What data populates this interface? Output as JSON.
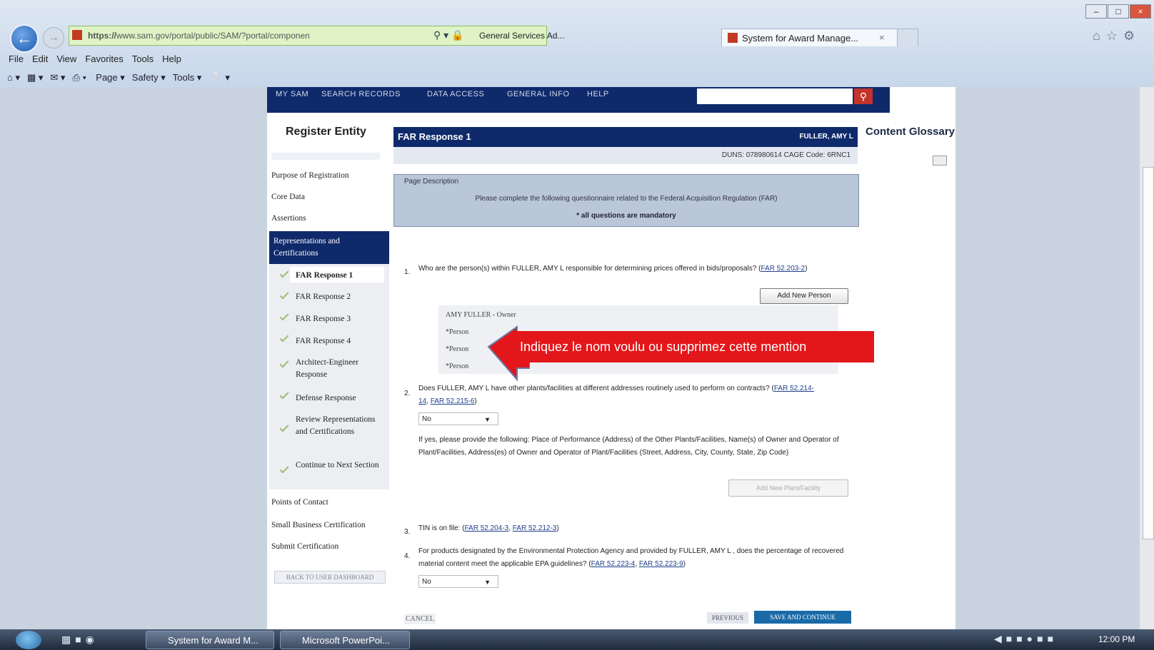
{
  "browser": {
    "url_prefix": "https://",
    "url": "www.sam.gov/portal/public/SAM/?portal/componen",
    "site_label": "General Services Ad...",
    "tab_title": "System for Award Manage...",
    "menu": [
      "File",
      "Edit",
      "View",
      "Favorites",
      "Tools",
      "Help"
    ],
    "command": [
      "Page ▾",
      "Safety ▾",
      "Tools ▾"
    ]
  },
  "sam_nav": [
    "MY SAM",
    "SEARCH RECORDS",
    "DATA ACCESS",
    "GENERAL INFO",
    "HELP"
  ],
  "sidebar": {
    "title": "Register Entity",
    "items": [
      "Purpose of Registration",
      "Core Data",
      "Assertions"
    ],
    "active_section": "Representations and Certifications",
    "sub_items": [
      "FAR Response 1",
      "FAR Response 2",
      "FAR Response 3",
      "FAR Response 4",
      "Architect-Engineer Response",
      "Defense Response",
      "Review Representations and Certifications",
      "Continue to Next Section"
    ],
    "lower_items": [
      "Points of Contact",
      "Small Business Certification",
      "Submit Certification"
    ],
    "back_dashboard": "BACK TO USER DASHBOARD"
  },
  "header": {
    "title": "FAR Response 1",
    "user": "FULLER, AMY L",
    "duns": "DUNS: 078980614   CAGE Code: 6RNC1"
  },
  "glossary": {
    "title": "Content Glossary"
  },
  "description": {
    "label": "Page Description",
    "text": "Please complete the following questionnaire related to the Federal Acquisition Regulation (FAR)",
    "note": "* all questions are mandatory"
  },
  "q1": {
    "num": "1.",
    "text": "Who are the person(s) within FULLER, AMY L responsible for determining prices offered in bids/proposals?",
    "link": "FAR 52.203-2",
    "add_button": "Add New Person",
    "persons": [
      "AMY FULLER - Owner",
      "*Person",
      "*Person",
      "*Person"
    ]
  },
  "callout": "Indiquez le nom voulu ou supprimez cette mention",
  "q2": {
    "num": "2.",
    "text": "Does FULLER, AMY L have other plants/facilities at different addresses routinely used to perform on contracts?",
    "links": [
      "FAR 52.214-14",
      "FAR 52.215-6"
    ],
    "value": "No",
    "extra": "If yes, please provide the following: Place of Performance (Address) of the Other Plants/Facilities, Name(s) of Owner and Operator of Plant/Facilities, Address(es) of Owner and Operator of Plant/Facilities (Street, Address, City, County, State, Zip Code)",
    "add_button": "Add New Plant/Facility"
  },
  "q3": {
    "num": "3.",
    "text": "TIN is on file:",
    "links": [
      "FAR 52.204-3",
      "FAR 52.212-3"
    ]
  },
  "q4": {
    "num": "4.",
    "text": "For products designated by the Environmental Protection Agency and provided by FULLER, AMY L , does the percentage of recovered material content meet the applicable EPA guidelines?",
    "links": [
      "FAR 52.223-4",
      "FAR 52.223-9"
    ],
    "value": "No"
  },
  "footer": {
    "cancel": "CANCEL",
    "previous": "PREVIOUS",
    "save": "SAVE AND CONTINUE"
  },
  "taskbar": {
    "task1": "System for Award M...",
    "task2": "Microsoft PowerPoi...",
    "clock": "12:00 PM"
  },
  "colors": {
    "nav_blue": "#0f2a6b",
    "callout_red": "#e3161a",
    "address_green": "#dff3c6"
  }
}
